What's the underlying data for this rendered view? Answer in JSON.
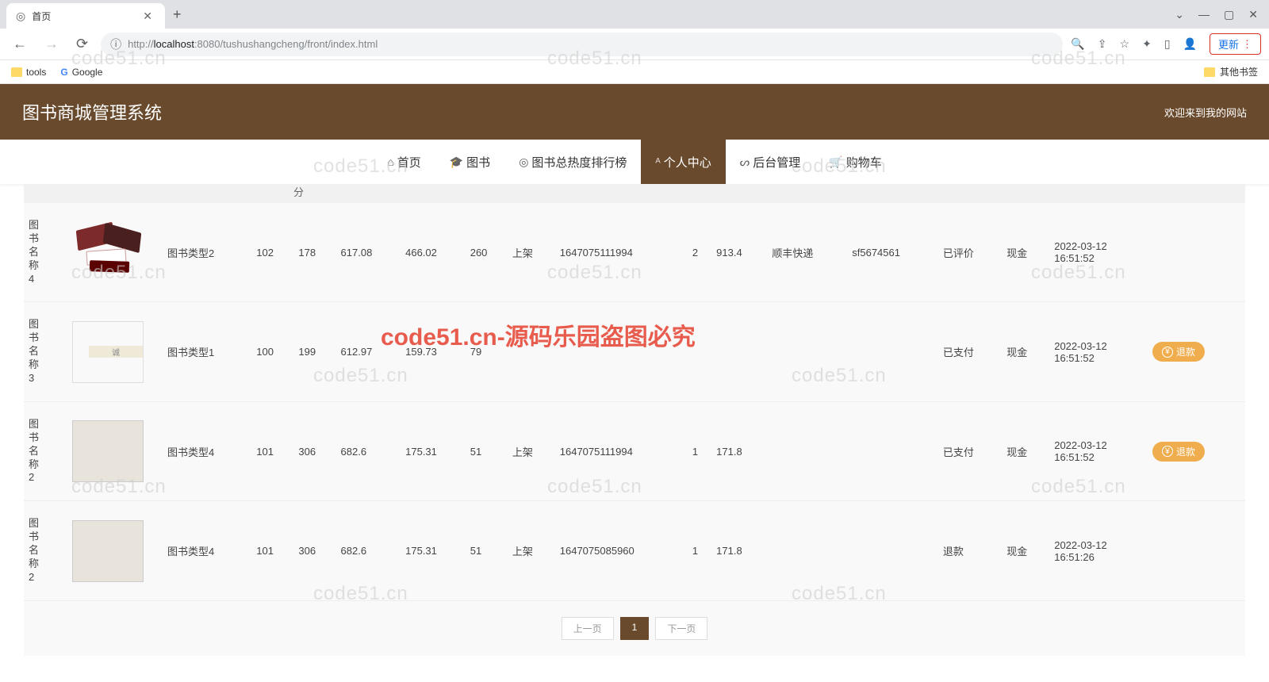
{
  "browser": {
    "tab_title": "首页",
    "url_full": "http://localhost:8080/tushushangcheng/front/index.html",
    "url_scheme": "http://",
    "url_host": "localhost",
    "url_port_path": ":8080/tushushangcheng/front/index.html",
    "update_label": "更新",
    "bookmark_tools": "tools",
    "bookmark_google": "Google",
    "other_bookmarks": "其他书签"
  },
  "header": {
    "title": "图书商城管理系统",
    "welcome": "欢迎来到我的网站"
  },
  "nav": {
    "home": "首页",
    "books": "图书",
    "ranking": "图书总热度排行榜",
    "personal": "个人中心",
    "admin": "后台管理",
    "cart": "购物车"
  },
  "filter_fragment": "分",
  "rows": [
    {
      "name": "图书名称4",
      "type_label": "图书类型2",
      "v1": "102",
      "v2": "178",
      "p1": "617.08",
      "p2": "466.02",
      "v3": "260",
      "status": "上架",
      "code": "1647075111994",
      "num": "2",
      "total": "913.4",
      "ship": "顺丰快递",
      "trackno": "sf5674561",
      "pay_status": "已评价",
      "pay_method": "现金",
      "date": "2022-03-12",
      "time": "16:51:52",
      "action": ""
    },
    {
      "name": "图书名称3",
      "type_label": "图书类型1",
      "v1": "100",
      "v2": "199",
      "p1": "612.97",
      "p2": "159.73",
      "v3": "79",
      "status": "",
      "code": "",
      "num": "",
      "total": "",
      "ship": "",
      "trackno": "",
      "pay_status": "已支付",
      "pay_method": "现金",
      "date": "2022-03-12",
      "time": "16:51:52",
      "action": "退款"
    },
    {
      "name": "图书名称2",
      "type_label": "图书类型4",
      "v1": "101",
      "v2": "306",
      "p1": "682.6",
      "p2": "175.31",
      "v3": "51",
      "status": "上架",
      "code": "1647075111994",
      "num": "1",
      "total": "171.8",
      "ship": "",
      "trackno": "",
      "pay_status": "已支付",
      "pay_method": "现金",
      "date": "2022-03-12",
      "time": "16:51:52",
      "action": "退款"
    },
    {
      "name": "图书名称2",
      "type_label": "图书类型4",
      "v1": "101",
      "v2": "306",
      "p1": "682.6",
      "p2": "175.31",
      "v3": "51",
      "status": "上架",
      "code": "1647075085960",
      "num": "1",
      "total": "171.8",
      "ship": "",
      "trackno": "",
      "pay_status": "退款",
      "pay_method": "现金",
      "date": "2022-03-12",
      "time": "16:51:26",
      "action": ""
    }
  ],
  "pagination": {
    "prev": "上一页",
    "current": "1",
    "next": "下一页"
  },
  "watermark": "code51.cn",
  "watermark_big": "code51.cn-源码乐园盗图必究"
}
